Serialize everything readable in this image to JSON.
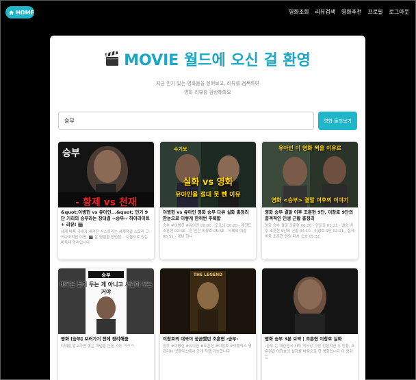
{
  "header": {
    "home_label": "HOME",
    "nav": [
      "영화조회",
      "리뷰검색",
      "영화추천",
      "프로필",
      "로그아웃"
    ]
  },
  "hero": {
    "title_icon": "clapperboard-icon",
    "title": "MOVIE 월드에 오신 걸 환영",
    "subtitle_line1": "지금 인기 있는 영화들을 살펴보고, 리뷰를 검색하여",
    "subtitle_line2": "영화 리뷰를 감상해봐요"
  },
  "search": {
    "value": "승부",
    "button_label": "영화 둘러보기"
  },
  "videos": [
    {
      "title": "&quot;이병헌 vs 유아인...&quot; 인기 9단 기리의 승부라는 창대결 ‹‹승부›› 하이라이트 + 리뷰! 🎬",
      "desc": "세계 바둑 국내가 새겨진 서스토리는 세계적걸 스토리 그 드라마적인 이변, 🎬 은 명절을 한번쯤... 다음으로 있는 바둑대 망라입니다"
    },
    {
      "title": "이병헌 vs 유아인 영화 승부 다큐 실화 총정리 한눈으로 이렇게 한꺼번 주목함",
      "desc": "승부 #이병헌 #유아인 00:00 - 오프닝 00:20 - 레전드 조훈현 02:56 - 한 인간 이창호 05:56 - 사제의 대결 08:51 - 계보 하나"
    },
    {
      "title": "영화 승부 결말 이후 조훈현 9단, 이창호 9단의 충격적인 인생 근황 총정리",
      "desc": "영화 승부 결말 조훈현 00:20 - 인트로 02:21 - 결승 이후 조훈현 9단의 근황 04:10 - 이창호 9단 02:11 - 실제 바둑 조훈현 엔딩 다시 소송 05:32"
    },
    {
      "title": "영화 [승부] 보러가기 전에 정리해줌",
      "desc": "디테일 알고가면 좋은 개념들 눈높 가능 ㅋㅋㅋ"
    },
    {
      "title": "이창호의 대국이 궁금했던 조훈현 ‹승부›",
      "desc": "승부 #이병헌 #유아인 #조훈현 #이창호 #넷플릭스 영화리뷰 넷플릭스에서 공개 직행 가능합니다"
    },
    {
      "title": "영화 승부 3분 요약 | 조훈현 이창호 실화",
      "desc": "‹승부›는 대한민국 바둑 역사상 가장 전설적인 두 인물, 조훈현과 이창호의 실화를 바탕으로 한 영화입니다 이 영화는"
    }
  ],
  "thumb_overlays": [
    [
      "승부",
      "- 황제 vs 천재"
    ],
    [
      "수기보",
      "실화 vs 영화",
      "유아인을 절대 못 뺀 이유"
    ],
    [
      "유아인 이 영화 찍을 이유로",
      "영화 <승부> 결말 이후의 이야기"
    ],
    [
      "바둑은 돌이 두는 게 아니고 사람이 두는 거야",
      "승부"
    ],
    [
      "THE LEGEND"
    ],
    [
      ""
    ]
  ],
  "colors": {
    "accent": "#1fb6c9",
    "title": "#1ba8c4",
    "red": "#e8232a",
    "yellow": "#ffd400"
  }
}
